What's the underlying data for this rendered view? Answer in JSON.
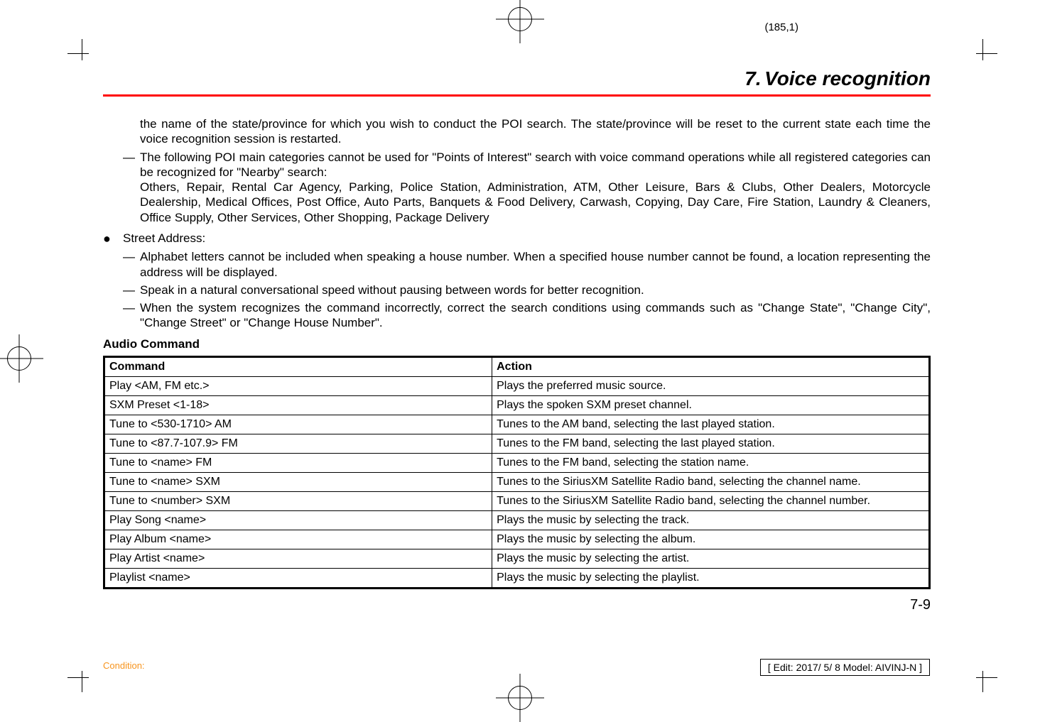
{
  "page_marker": "(185,1)",
  "header": {
    "section_number": "7.",
    "section_title": "Voice recognition"
  },
  "body": {
    "p1": "the name of the state/province for which you wish to conduct the POI search. The state/province will be reset to the current state each time the voice recognition session is restarted.",
    "dash1_intro": "The following POI main categories cannot be used for \"Points of Interest\" search with voice command operations while all registered categories can be recognized for \"Nearby\" search:",
    "dash1_list": "Others, Repair, Rental Car Agency, Parking, Police Station, Administration, ATM, Other Leisure, Bars & Clubs, Other Dealers, Motorcycle Dealership, Medical Offices, Post Office, Auto Parts, Banquets & Food Delivery, Carwash, Copying, Day Care, Fire Station, Laundry & Cleaners, Office Supply, Other Services, Other Shopping, Package Delivery",
    "bullet1": "Street Address:",
    "nd1": "Alphabet letters cannot be included when speaking a house number. When a specified house number cannot be found, a location representing the address will be displayed.",
    "nd2": "Speak in a natural conversational speed without pausing between words for better recognition.",
    "nd3": "When the system recognizes the command incorrectly, correct the search conditions using commands such as \"Change State\", \"Change City\", \"Change Street\" or \"Change House Number\"."
  },
  "table": {
    "heading": "Audio Command",
    "th_command": "Command",
    "th_action": "Action",
    "rows": [
      {
        "cmd": "Play <AM, FM etc.>",
        "act": "Plays the preferred music source."
      },
      {
        "cmd": "SXM Preset <1-18>",
        "act": "Plays the spoken SXM preset channel."
      },
      {
        "cmd": "Tune to <530-1710> AM",
        "act": "Tunes to the AM band, selecting the last played station."
      },
      {
        "cmd": "Tune to <87.7-107.9> FM",
        "act": "Tunes to the FM band, selecting the last played station."
      },
      {
        "cmd": "Tune to <name> FM",
        "act": "Tunes to the FM band, selecting the station name."
      },
      {
        "cmd": "Tune to <name> SXM",
        "act": "Tunes to the SiriusXM Satellite Radio band, selecting the channel name."
      },
      {
        "cmd": "Tune to <number> SXM",
        "act": "Tunes to the SiriusXM Satellite Radio band, selecting the channel number."
      },
      {
        "cmd": "Play Song <name>",
        "act": "Plays the music by selecting the track."
      },
      {
        "cmd": "Play Album <name>",
        "act": "Plays the music by selecting the album."
      },
      {
        "cmd": "Play Artist <name>",
        "act": "Plays the music by selecting the artist."
      },
      {
        "cmd": "Playlist <name>",
        "act": "Plays the music by selecting the playlist."
      }
    ]
  },
  "page_number": "7-9",
  "footer": {
    "left": "Condition:",
    "right": "[ Edit: 2017/ 5/ 8   Model: AIVINJ-N ]"
  },
  "symbols": {
    "dash": "—",
    "bullet": "●"
  }
}
